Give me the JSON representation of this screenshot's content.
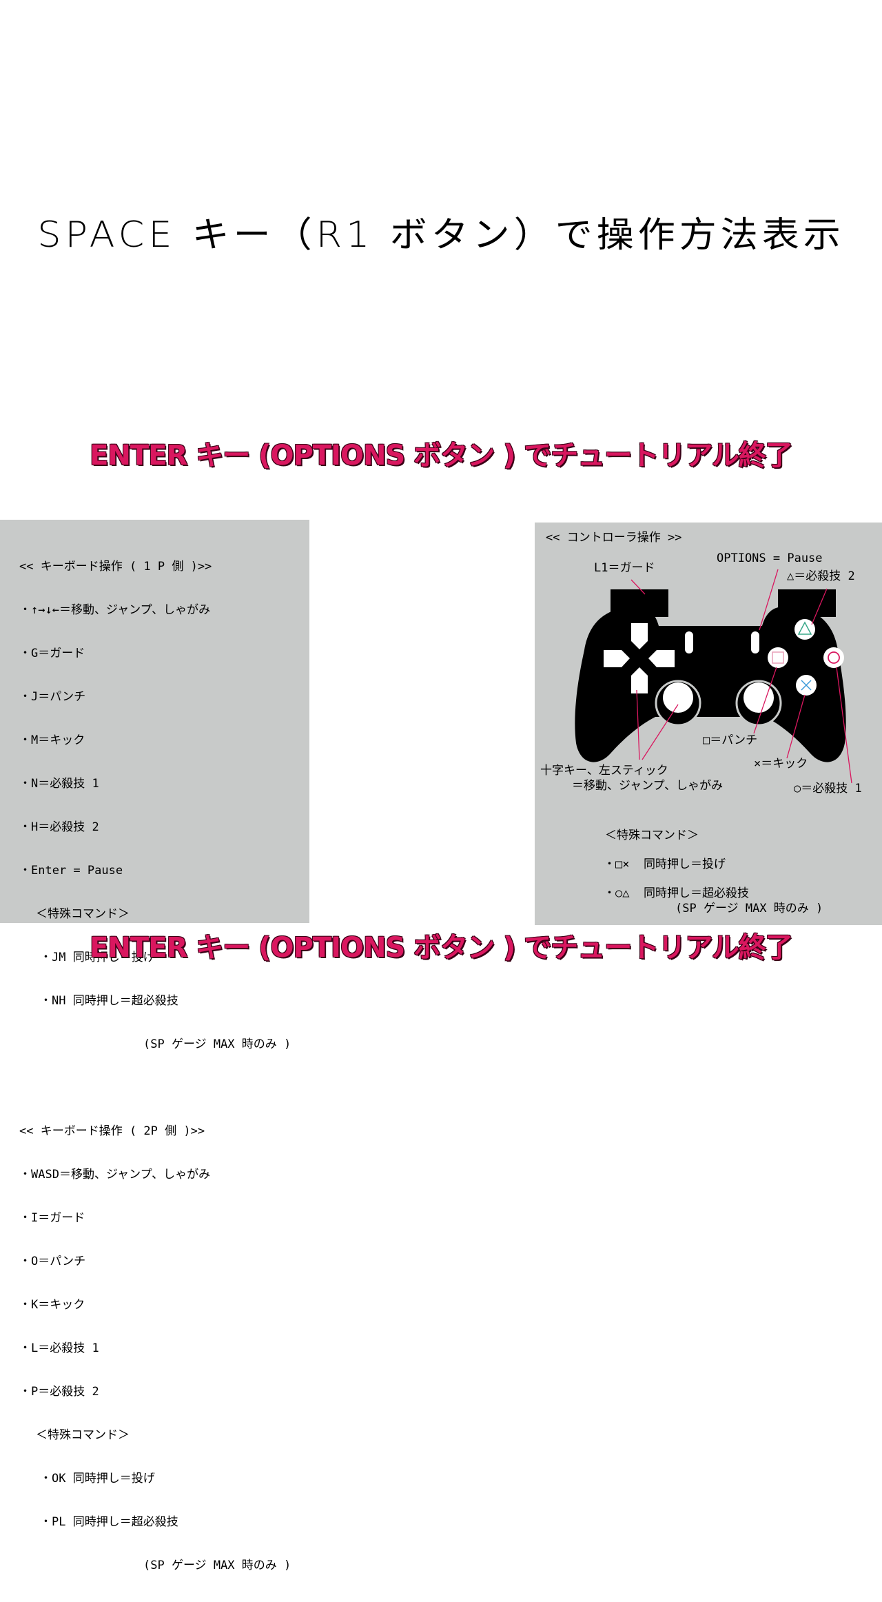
{
  "space_title": "SPACE キー（R1 ボタン）で操作方法表示",
  "enter_banner": "ENTER キー (OPTIONS ボタン ) でチュートリアル終了",
  "keyboard_1p": {
    "header": "<< キーボード操作 ( 1 P 側 )>>",
    "lines": [
      "・↑→↓←＝移動、ジャンプ、しゃがみ",
      "・G＝ガード",
      "・J＝パンチ",
      "・M＝キック",
      "・N＝必殺技 1",
      "・H＝必殺技 2",
      "・Enter = Pause"
    ],
    "special_header": "＜特殊コマンド＞",
    "special": [
      "・JM 同時押し＝投げ",
      "・NH 同時押し＝超必殺技"
    ],
    "note": "(SP ゲージ MAX 時のみ )"
  },
  "keyboard_2p": {
    "header": "<< キーボード操作 ( 2P 側 )>>",
    "lines": [
      "・WASD＝移動、ジャンプ、しゃがみ",
      "・I＝ガード",
      "・O＝パンチ",
      "・K＝キック",
      "・L＝必殺技 1",
      "・P＝必殺技 2"
    ],
    "special_header": "＜特殊コマンド＞",
    "special": [
      "・OK 同時押し＝投げ",
      "・PL 同時押し＝超必殺技"
    ],
    "note": "(SP ゲージ MAX 時のみ )"
  },
  "controller": {
    "header": "<< コントローラ操作 >>",
    "l1": "L1＝ガード",
    "options": "OPTIONS = Pause",
    "triangle": "△＝必殺技 2",
    "square": "□＝パンチ",
    "cross": "×＝キック",
    "circle": "○＝必殺技 1",
    "dpad_line1": "十字キー、左スティック",
    "dpad_line2": "＝移動、ジャンプ、しゃがみ",
    "special_header": "＜特殊コマンド＞",
    "special1": "・□×  同時押し＝投げ",
    "special2": "・○△  同時押し＝超必殺技",
    "note": "(SP ゲージ MAX 時のみ )",
    "colors": {
      "triangle": "#3aa88a",
      "square": "#e8a0b8",
      "cross": "#3a9ad9",
      "circle": "#d9175f"
    }
  }
}
